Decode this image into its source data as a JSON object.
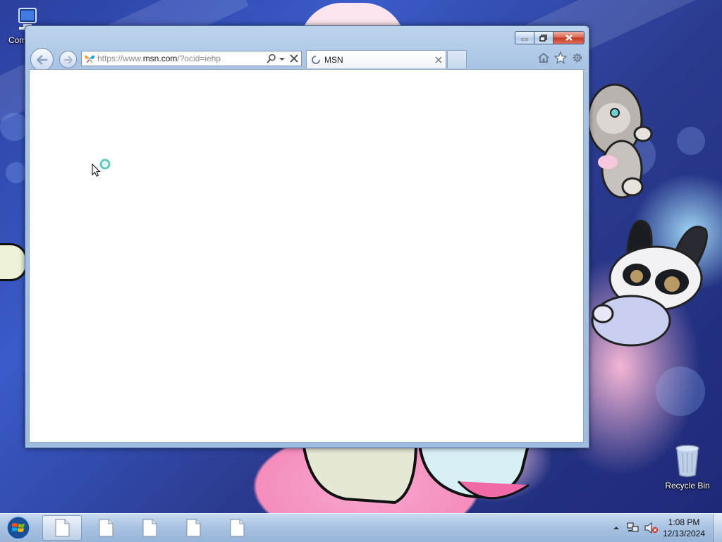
{
  "desktop": {
    "icons": [
      {
        "label": "Com",
        "icon": "computer-icon"
      },
      {
        "label": "Recycle Bin",
        "icon": "recycle-bin-icon"
      }
    ]
  },
  "browser": {
    "address": {
      "prefix": "https://www.",
      "domain": "msn.com",
      "suffix": "/?ocid=iehp"
    },
    "tabs": [
      {
        "title": "MSN",
        "state": "loading"
      }
    ],
    "buttons": {
      "back": "back-icon",
      "forward": "forward-icon",
      "search": "search-icon",
      "dropdown": "chevron-down-icon",
      "stop": "stop-icon",
      "home": "home-icon",
      "favorites": "star-icon",
      "tools": "gear-icon"
    }
  },
  "taskbar": {
    "pinned": [
      "document-icon",
      "document-icon",
      "document-icon",
      "document-icon",
      "document-icon"
    ],
    "tray_icons": [
      "show-hidden-icons",
      "network-icon",
      "volume-muted-icon"
    ],
    "clock": {
      "time": "1:08 PM",
      "date": "12/13/2024"
    }
  },
  "colors": {
    "taskbar": "#a9c3e2",
    "window_frame": "#a9c4e4",
    "close_button": "#c3381f"
  }
}
